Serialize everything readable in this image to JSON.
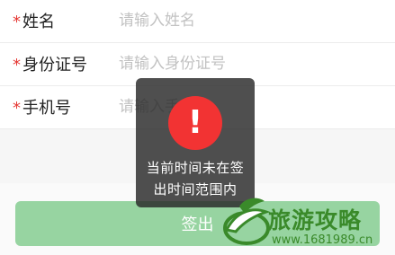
{
  "form": {
    "fields": [
      {
        "required_mark": "*",
        "label": "姓名",
        "placeholder": "请输入姓名"
      },
      {
        "required_mark": "*",
        "label": "身份证号",
        "placeholder": "请输入身份证号"
      },
      {
        "required_mark": "*",
        "label": "手机号",
        "placeholder": "请输入手机号"
      }
    ],
    "submit_label": "签出"
  },
  "toast": {
    "icon": "exclamation-icon",
    "symbol": "!",
    "message": "当前时间未在签出时间范围内"
  },
  "watermark": {
    "brand": "旅游攻略",
    "url": "www.1681989.cn"
  },
  "colors": {
    "required": "#e53935",
    "submit_bg": "#97d4a1",
    "toast_icon": "#f23333",
    "watermark": "#3a8a2a"
  }
}
